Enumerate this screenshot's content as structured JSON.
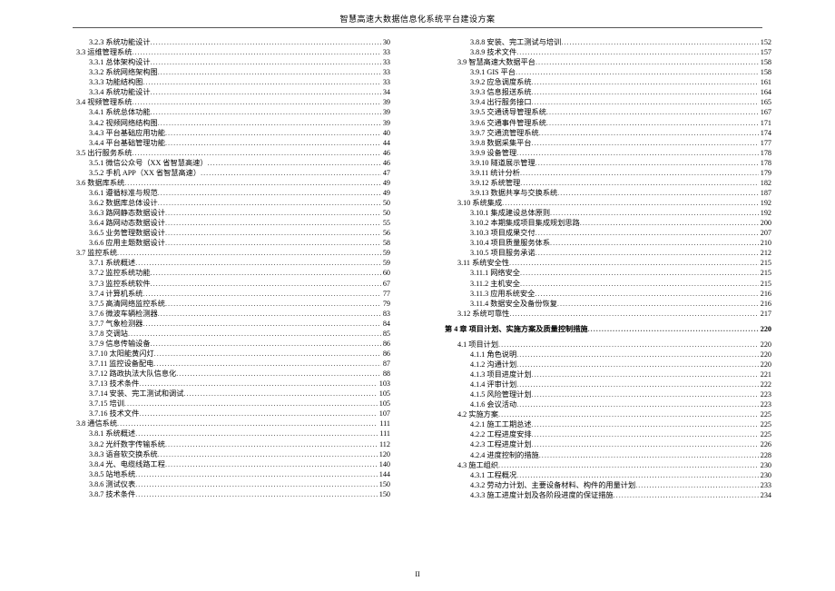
{
  "header_title": "智慧高速大数据信息化系统平台建设方案",
  "page_number": "II",
  "columns": [
    [
      {
        "label": "3.2.3 系统功能设计",
        "page": "30",
        "indent": 2
      },
      {
        "label": "3.3 运维管理系统",
        "page": "33",
        "indent": 1
      },
      {
        "label": "3.3.1 总体架构设计",
        "page": "33",
        "indent": 2
      },
      {
        "label": "3.3.2 系统网络架构图",
        "page": "33",
        "indent": 2
      },
      {
        "label": "3.3.3 功能结构图",
        "page": "33",
        "indent": 2
      },
      {
        "label": "3.3.4 系统功能设计",
        "page": "34",
        "indent": 2
      },
      {
        "label": "3.4 视频管理系统",
        "page": "39",
        "indent": 1
      },
      {
        "label": "3.4.1 系统总体功能",
        "page": "39",
        "indent": 2
      },
      {
        "label": "3.4.2 视频网络结构图",
        "page": "39",
        "indent": 2
      },
      {
        "label": "3.4.3 平台基础应用功能",
        "page": "40",
        "indent": 2
      },
      {
        "label": "3.4.4 平台基础管理功能",
        "page": "44",
        "indent": 2
      },
      {
        "label": "3.5 出行服务系统",
        "page": "46",
        "indent": 1
      },
      {
        "label": "3.5.1 微信公众号（XX 省智慧高速）",
        "page": "46",
        "indent": 2
      },
      {
        "label": "3.5.2 手机 APP（XX 省智慧高速）",
        "page": "47",
        "indent": 2
      },
      {
        "label": "3.6 数据库系统",
        "page": "49",
        "indent": 1
      },
      {
        "label": "3.6.1 遵循标准与规范",
        "page": "49",
        "indent": 2
      },
      {
        "label": "3.6.2 数据库总体设计",
        "page": "50",
        "indent": 2
      },
      {
        "label": "3.6.3 路网静态数据设计",
        "page": "50",
        "indent": 2
      },
      {
        "label": "3.6.4 路网动态数据设计",
        "page": "55",
        "indent": 2
      },
      {
        "label": "3.6.5 业务管理数据设计",
        "page": "56",
        "indent": 2
      },
      {
        "label": "3.6.6 应用主题数据设计",
        "page": "58",
        "indent": 2
      },
      {
        "label": "3.7 监控系统",
        "page": "59",
        "indent": 1
      },
      {
        "label": "3.7.1 系统概述",
        "page": "59",
        "indent": 2
      },
      {
        "label": "3.7.2 监控系统功能",
        "page": "60",
        "indent": 2
      },
      {
        "label": "3.7.3 监控系统软件",
        "page": "67",
        "indent": 2
      },
      {
        "label": "3.7.4 计算机系统",
        "page": "77",
        "indent": 2
      },
      {
        "label": "3.7.5 高清网络监控系统",
        "page": "79",
        "indent": 2
      },
      {
        "label": "3.7.6 微波车辆检测器",
        "page": "83",
        "indent": 2
      },
      {
        "label": "3.7.7 气象检测器",
        "page": "84",
        "indent": 2
      },
      {
        "label": "3.7.8 交调站",
        "page": "85",
        "indent": 2
      },
      {
        "label": "3.7.9 信息传输设备",
        "page": "86",
        "indent": 2
      },
      {
        "label": "3.7.10 太阳能黄闪灯",
        "page": "86",
        "indent": 2
      },
      {
        "label": "3.7.11 监控设备配电",
        "page": "87",
        "indent": 2
      },
      {
        "label": "3.7.12 路政执法大队信息化",
        "page": "88",
        "indent": 2
      },
      {
        "label": "3.7.13 技术条件",
        "page": "103",
        "indent": 2
      },
      {
        "label": "3.7.14 安装、完工测试和调试",
        "page": "105",
        "indent": 2
      },
      {
        "label": "3.7.15 培训",
        "page": "105",
        "indent": 2
      },
      {
        "label": "3.7.16 技术文件",
        "page": "107",
        "indent": 2
      },
      {
        "label": "3.8 通信系统",
        "page": "111",
        "indent": 1
      },
      {
        "label": "3.8.1 系统概述",
        "page": "111",
        "indent": 2
      },
      {
        "label": "3.8.2 光纤数字传输系统",
        "page": "112",
        "indent": 2
      },
      {
        "label": "3.8.3 语音软交换系统",
        "page": "120",
        "indent": 2
      },
      {
        "label": "3.8.4 光、电缆线路工程",
        "page": "140",
        "indent": 2
      },
      {
        "label": "3.8.5 站地系统",
        "page": "144",
        "indent": 2
      },
      {
        "label": "3.8.6 测试仪表",
        "page": "150",
        "indent": 2
      },
      {
        "label": "3.8.7 技术条件",
        "page": "150",
        "indent": 2
      }
    ],
    [
      {
        "label": "3.8.8 安装、完工测试与培训",
        "page": "152",
        "indent": 2
      },
      {
        "label": "3.8.9 技术文件",
        "page": "157",
        "indent": 2
      },
      {
        "label": "3.9 智慧高速大数据平台",
        "page": "158",
        "indent": 1
      },
      {
        "label": "3.9.1 GIS 平台",
        "page": "158",
        "indent": 2
      },
      {
        "label": "3.9.2 应急调度系统",
        "page": "161",
        "indent": 2
      },
      {
        "label": "3.9.3 信息报送系统",
        "page": "164",
        "indent": 2
      },
      {
        "label": "3.9.4 出行服务接口",
        "page": "165",
        "indent": 2
      },
      {
        "label": "3.9.5 交通诱导管理系统",
        "page": "167",
        "indent": 2
      },
      {
        "label": "3.9.6 交通事件管理系统",
        "page": "171",
        "indent": 2
      },
      {
        "label": "3.9.7 交通流管理系统",
        "page": "174",
        "indent": 2
      },
      {
        "label": "3.9.8 数据采集平台",
        "page": "177",
        "indent": 2
      },
      {
        "label": "3.9.9 设备管理",
        "page": "178",
        "indent": 2
      },
      {
        "label": "3.9.10 隧道展示管理",
        "page": "178",
        "indent": 2
      },
      {
        "label": "3.9.11 统计分析",
        "page": "179",
        "indent": 2
      },
      {
        "label": "3.9.12 系统管理",
        "page": "182",
        "indent": 2
      },
      {
        "label": "3.9.13 数据共享与交换系统",
        "page": "187",
        "indent": 2
      },
      {
        "label": "3.10 系统集成",
        "page": "192",
        "indent": 1
      },
      {
        "label": "3.10.1 集成建设总体原则",
        "page": "192",
        "indent": 2
      },
      {
        "label": "3.10.2 本期集成项目集成规划思路",
        "page": "200",
        "indent": 2
      },
      {
        "label": "3.10.3 项目成果交付",
        "page": "207",
        "indent": 2
      },
      {
        "label": "3.10.4 项目质量服务体系",
        "page": "210",
        "indent": 2
      },
      {
        "label": "3.10.5 项目服务承诺",
        "page": "212",
        "indent": 2
      },
      {
        "label": "3.11 系统安全性",
        "page": "215",
        "indent": 1
      },
      {
        "label": "3.11.1 网络安全",
        "page": "215",
        "indent": 2
      },
      {
        "label": "3.11.2 主机安全",
        "page": "215",
        "indent": 2
      },
      {
        "label": "3.11.3 应用系统安全",
        "page": "216",
        "indent": 2
      },
      {
        "label": "3.11.4 数据安全及备份恢复",
        "page": "216",
        "indent": 2
      },
      {
        "label": "3.12 系统可靠性",
        "page": "217",
        "indent": 1
      },
      {
        "label": "第 4 章  项目计划、实施方案及质量控制措施",
        "page": "220",
        "indent": 0,
        "chapter": true,
        "spacer_before": true
      },
      {
        "label": "4.1 项目计划",
        "page": "220",
        "indent": 1,
        "spacer_before": true
      },
      {
        "label": "4.1.1 角色说明",
        "page": "220",
        "indent": 2
      },
      {
        "label": "4.1.2 沟通计划",
        "page": "220",
        "indent": 2
      },
      {
        "label": "4.1.3 项目进度计划",
        "page": "221",
        "indent": 2
      },
      {
        "label": "4.1.4 评审计划",
        "page": "222",
        "indent": 2
      },
      {
        "label": "4.1.5 风险管理计划",
        "page": "223",
        "indent": 2
      },
      {
        "label": "4.1.6 会议活动",
        "page": "223",
        "indent": 2
      },
      {
        "label": "4.2 实施方案",
        "page": "225",
        "indent": 1
      },
      {
        "label": "4.2.1 施工工期总述",
        "page": "225",
        "indent": 2
      },
      {
        "label": "4.2.2 工程进度安排",
        "page": "225",
        "indent": 2
      },
      {
        "label": "4.2.3 工程进度计划",
        "page": "226",
        "indent": 2
      },
      {
        "label": "4.2.4 进度控制的措施",
        "page": "228",
        "indent": 2
      },
      {
        "label": "4.3 施工组织",
        "page": "230",
        "indent": 1
      },
      {
        "label": "4.3.1 工程概况",
        "page": "230",
        "indent": 2
      },
      {
        "label": "4.3.2 劳动力计划、主要设备材料、构件的用量计划",
        "page": "233",
        "indent": 2
      },
      {
        "label": "4.3.3 施工进度计划及各阶段进度的保证措施",
        "page": "234",
        "indent": 2
      }
    ]
  ]
}
